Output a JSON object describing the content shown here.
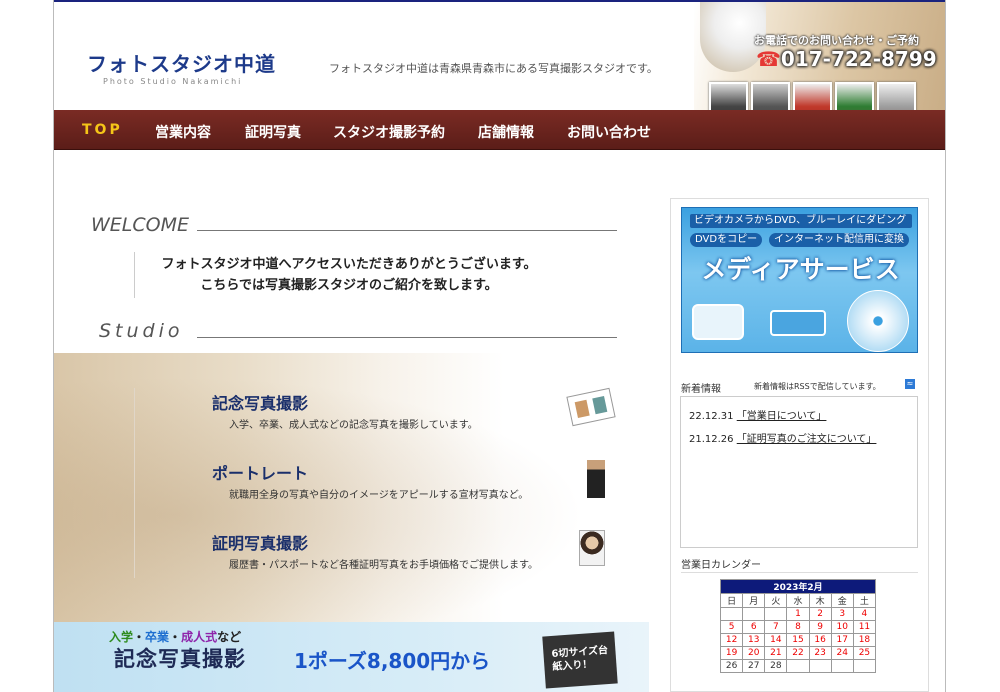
{
  "header": {
    "logo_jp": "フォトスタジオ中道",
    "logo_en": "Photo Studio Nakamichi",
    "tagline": "フォトスタジオ中道は青森県青森市にある写真撮影スタジオです。",
    "contact_label": "お電話でのお問い合わせ・ご予約",
    "phone": "017-722-8799"
  },
  "nav": [
    "TOP",
    "営業内容",
    "証明写真",
    "スタジオ撮影予約",
    "店舗情報",
    "お問い合わせ"
  ],
  "welcome": {
    "heading": "WELCOME",
    "line1": "フォトスタジオ中道へアクセスいただきありがとうございます。",
    "line2": "こちらでは写真撮影スタジオのご紹介を致します。"
  },
  "studio": {
    "heading": "Studio",
    "services": [
      {
        "title": "記念写真撮影",
        "desc": "入学、卒業、成人式などの記念写真を撮影しています。"
      },
      {
        "title": "ポートレート",
        "desc": "就職用全身の写真や自分のイメージをアピールする宣材写真など。"
      },
      {
        "title": "証明写真撮影",
        "desc": "履歴書・パスポートなど各種証明写真をお手頃価格でご提供します。"
      }
    ]
  },
  "banner": {
    "sub_parts": [
      "入学",
      "・",
      "卒業",
      "・",
      "成人式",
      "など"
    ],
    "main": "記念写真撮影",
    "price": "1ポーズ8,800円から",
    "book": "6切サイズ台紙入り！"
  },
  "media": {
    "line1": "ビデオカメラからDVD、ブルーレイにダビング",
    "pill1": "DVDをコピー",
    "pill2": "インターネット配信用に変換",
    "title": "メディアサービス"
  },
  "news": {
    "label": "新着情報",
    "rss_note": "新着情報はRSSで配信しています。",
    "items": [
      {
        "date": "22.12.31",
        "text": "「営業日について」"
      },
      {
        "date": "21.12.26",
        "text": "「証明写真のご注文について」"
      }
    ]
  },
  "calendar": {
    "label": "営業日カレンダー",
    "caption": "2023年2月",
    "weekdays": [
      "日",
      "月",
      "火",
      "水",
      "木",
      "金",
      "土"
    ],
    "weeks": [
      [
        "",
        "",
        "",
        "1",
        "2",
        "3",
        "4"
      ],
      [
        "5",
        "6",
        "7",
        "8",
        "9",
        "10",
        "11"
      ],
      [
        "12",
        "13",
        "14",
        "15",
        "16",
        "17",
        "18"
      ],
      [
        "19",
        "20",
        "21",
        "22",
        "23",
        "24",
        "25"
      ],
      [
        "26",
        "27",
        "28",
        "",
        "",
        "",
        ""
      ]
    ]
  },
  "colors": {
    "nav_bg": "#6b241e",
    "nav_active": "#f5c518",
    "brand_blue": "#1d3a8a"
  }
}
